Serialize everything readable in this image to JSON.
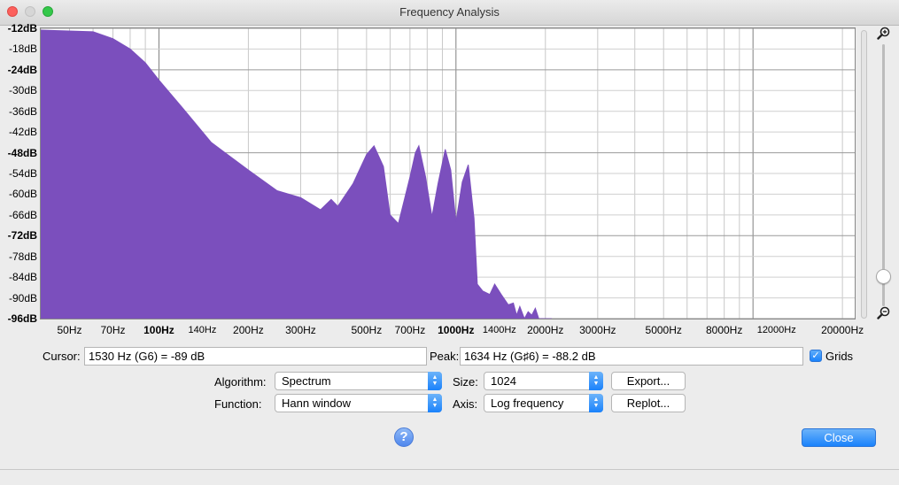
{
  "window": {
    "title": "Frequency Analysis"
  },
  "chart_data": {
    "type": "area",
    "title": "",
    "xlabel": "",
    "ylabel": "",
    "x_scale": "log",
    "xlim": [
      40,
      22000
    ],
    "ylim": [
      -96,
      -12
    ],
    "grid": true,
    "color": "#7b4fbd",
    "y_ticks": [
      "-12dB",
      "-18dB",
      "-24dB",
      "-30dB",
      "-36dB",
      "-42dB",
      "-48dB",
      "-54dB",
      "-60dB",
      "-66dB",
      "-72dB",
      "-78dB",
      "-84dB",
      "-90dB",
      "-96dB"
    ],
    "y_bold_ticks": [
      "-12dB",
      "-24dB",
      "-48dB",
      "-72dB",
      "-96dB"
    ],
    "x_tick_labels": [
      {
        "f": 50,
        "label": "50Hz"
      },
      {
        "f": 70,
        "label": "70Hz"
      },
      {
        "f": 100,
        "label": "100Hz",
        "bold": true
      },
      {
        "f": 140,
        "label": "140Hz",
        "small": true
      },
      {
        "f": 200,
        "label": "200Hz"
      },
      {
        "f": 300,
        "label": "300Hz"
      },
      {
        "f": 500,
        "label": "500Hz"
      },
      {
        "f": 700,
        "label": "700Hz"
      },
      {
        "f": 1000,
        "label": "1000Hz",
        "bold": true
      },
      {
        "f": 1400,
        "label": "1400Hz",
        "small": true
      },
      {
        "f": 2000,
        "label": "2000Hz"
      },
      {
        "f": 3000,
        "label": "3000Hz"
      },
      {
        "f": 5000,
        "label": "5000Hz"
      },
      {
        "f": 8000,
        "label": "8000Hz"
      },
      {
        "f": 12000,
        "label": "12000Hz",
        "small": true
      },
      {
        "f": 20000,
        "label": "20000Hz"
      }
    ],
    "x": [
      40,
      60,
      70,
      80,
      90,
      100,
      120,
      150,
      200,
      250,
      300,
      350,
      380,
      400,
      450,
      500,
      530,
      570,
      600,
      640,
      700,
      730,
      750,
      790,
      830,
      870,
      920,
      960,
      1000,
      1050,
      1100,
      1150,
      1180,
      1230,
      1300,
      1350,
      1420,
      1500,
      1560,
      1600,
      1640,
      1700,
      1750,
      1800,
      1850,
      1900,
      1950,
      2000,
      2100
    ],
    "y": [
      -12.5,
      -13,
      -15,
      -18,
      -22,
      -27,
      -35,
      -45,
      -53,
      -59,
      -61,
      -64.5,
      -61.5,
      -63.5,
      -57,
      -48.5,
      -46,
      -52,
      -66,
      -68.5,
      -55,
      -48,
      -46,
      -55,
      -66.5,
      -57,
      -47,
      -53,
      -68,
      -56.5,
      -51.5,
      -67,
      -86,
      -88,
      -89,
      -86,
      -89,
      -92,
      -91.5,
      -95,
      -92.5,
      -97,
      -94,
      -95,
      -93,
      -96.5,
      -96,
      -97,
      -98
    ]
  },
  "zoom": {
    "in_icon": "zoom-in-icon",
    "out_icon": "zoom-out-icon",
    "level": 0.08
  },
  "readouts": {
    "cursor_label": "Cursor:",
    "cursor_value": "1530 Hz (G6) = -89 dB",
    "peak_label": "Peak:",
    "peak_value": "1634 Hz (G♯6) = -88.2 dB",
    "grids_label": "Grids",
    "grids_checked": true
  },
  "controls": {
    "algorithm_label": "Algorithm:",
    "algorithm_value": "Spectrum",
    "function_label": "Function:",
    "function_value": "Hann window",
    "size_label": "Size:",
    "size_value": "1024",
    "axis_label": "Axis:",
    "axis_value": "Log frequency",
    "export_label": "Export...",
    "replot_label": "Replot...",
    "help_label": "?",
    "close_label": "Close"
  }
}
